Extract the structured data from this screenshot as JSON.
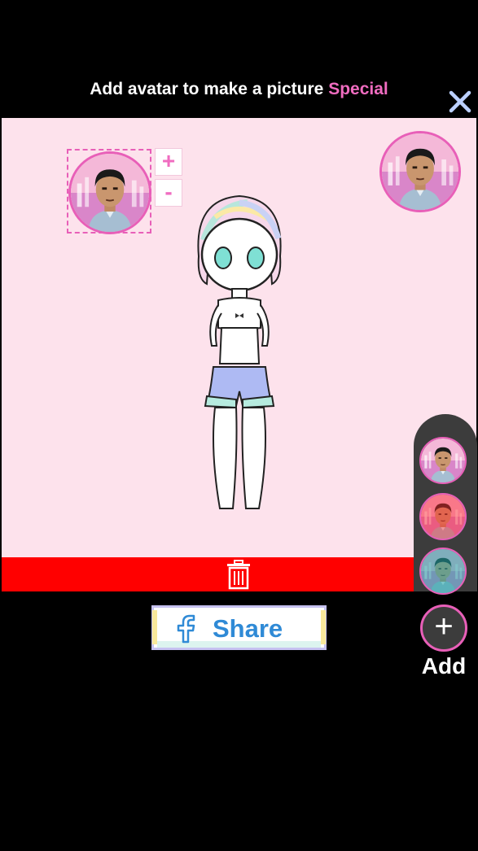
{
  "header": {
    "title_prefix": "Add avatar to make a picture",
    "title_highlight": "Special",
    "close_icon": "close-icon"
  },
  "colors": {
    "accent_pink": "#f06cc0",
    "canvas_bg": "#fde2ec",
    "trash_bar": "#ff0000",
    "share_text": "#2f8ad6",
    "panel_bg": "#3c3c3c"
  },
  "canvas": {
    "zoom_in_label": "+",
    "zoom_out_label": "-"
  },
  "trash": {
    "icon": "trash-icon"
  },
  "share": {
    "label": "Share",
    "icon": "facebook-icon"
  },
  "side_panel": {
    "avatars": [
      {
        "tint": "normal"
      },
      {
        "tint": "red"
      },
      {
        "tint": "teal"
      }
    ],
    "add_symbol": "+",
    "add_label": "Add"
  }
}
